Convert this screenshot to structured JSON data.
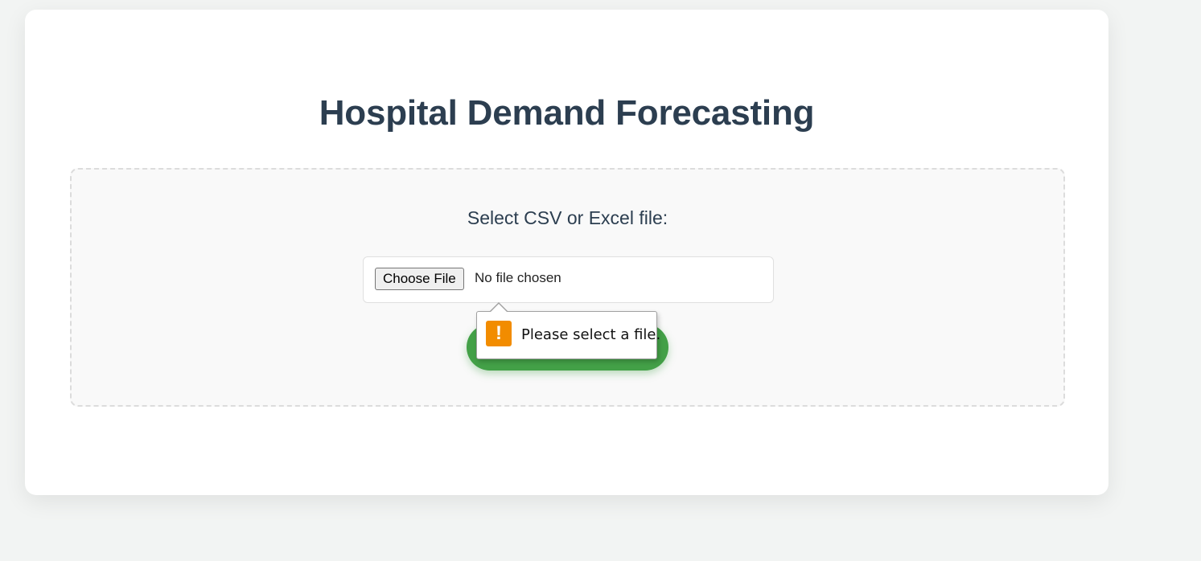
{
  "page": {
    "title": "Hospital Demand Forecasting",
    "select_label": "Select CSV or Excel file:"
  },
  "file_input": {
    "button_label": "Choose File",
    "status_text": "No file chosen"
  },
  "upload_button": {
    "label": ""
  },
  "validation": {
    "icon": "warning-icon",
    "icon_glyph": "!",
    "message": "Please select a file."
  },
  "colors": {
    "title": "#2c3e50",
    "accent_green": "#43a047",
    "warning_orange": "#f28c00"
  }
}
